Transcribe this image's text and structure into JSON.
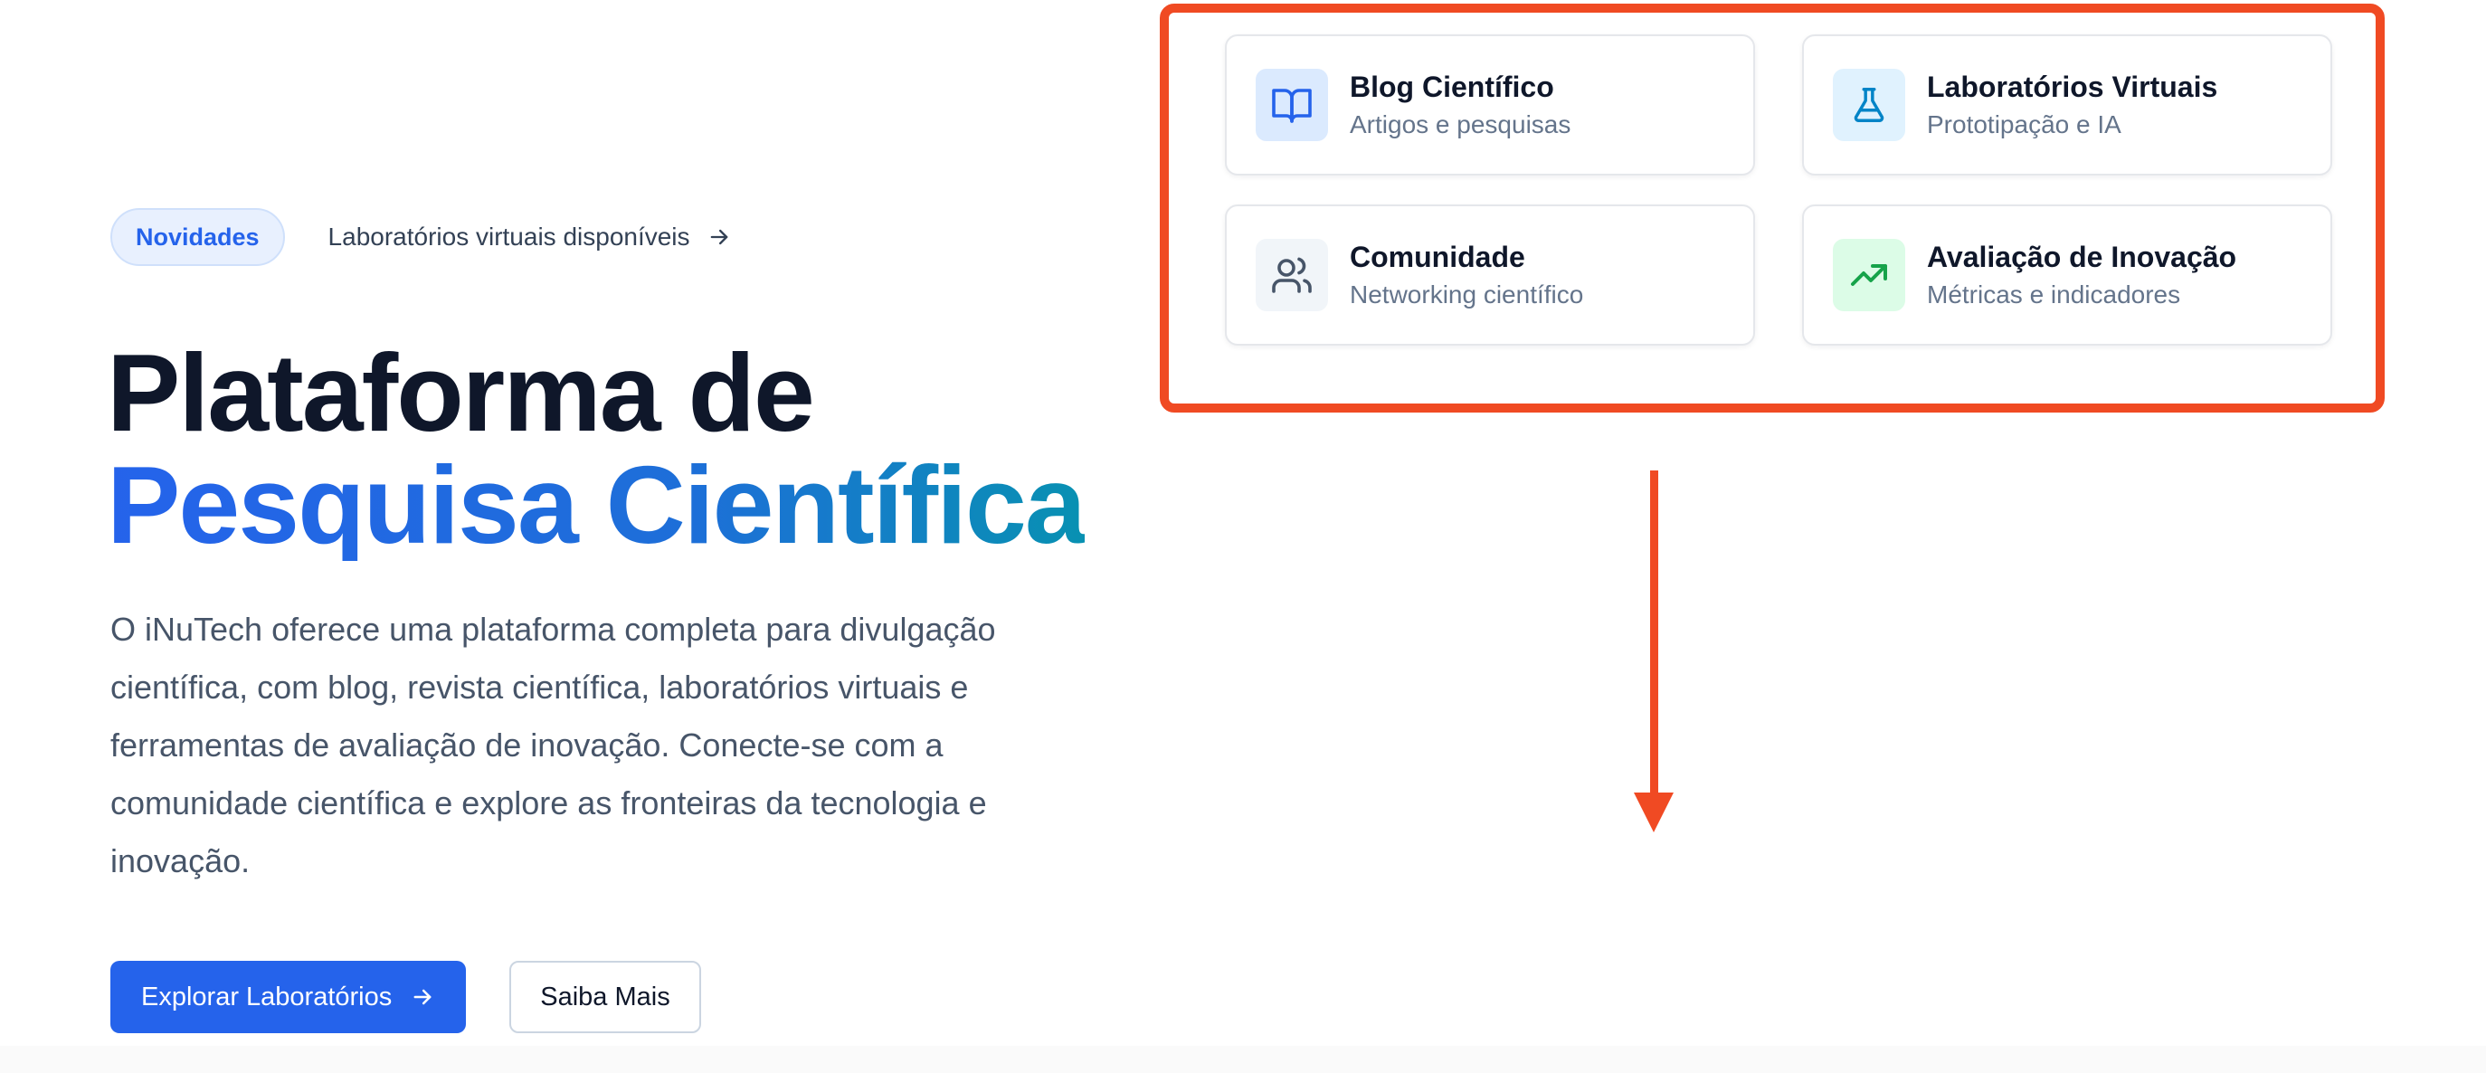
{
  "announcement": {
    "badge": "Novidades",
    "link_text": "Laboratórios virtuais disponíveis",
    "link_icon": "arrow-right-icon"
  },
  "hero": {
    "title_line1": "Plataforma de",
    "title_line2": "Pesquisa Científica",
    "description": "O iNuTech oferece uma plataforma completa para divulgação científica, com blog, revista científica, laboratórios virtuais e ferramentas de avaliação de inovação. Conecte-se com a comunidade científica e explore as fronteiras da tecnologia e inovação."
  },
  "actions": {
    "primary_label": "Explorar Laboratórios",
    "primary_icon": "arrow-right-icon",
    "secondary_label": "Saiba Mais"
  },
  "features": [
    {
      "title": "Blog Científico",
      "subtitle": "Artigos e pesquisas",
      "icon": "book-open-icon",
      "icon_color": "#2563eb",
      "icon_bg": "#dbeafe"
    },
    {
      "title": "Laboratórios Virtuais",
      "subtitle": "Prototipação e IA",
      "icon": "flask-icon",
      "icon_color": "#0284c7",
      "icon_bg": "#e0f2fe"
    },
    {
      "title": "Comunidade",
      "subtitle": "Networking científico",
      "icon": "users-icon",
      "icon_color": "#475569",
      "icon_bg": "#f1f5f9"
    },
    {
      "title": "Avaliação de Inovação",
      "subtitle": "Métricas e indicadores",
      "icon": "trending-up-icon",
      "icon_color": "#16a34a",
      "icon_bg": "#dcfce7"
    }
  ],
  "colors": {
    "accent": "#2563eb",
    "annotation": "#f04a23",
    "title": "#0f172a",
    "body_text": "#475569"
  }
}
